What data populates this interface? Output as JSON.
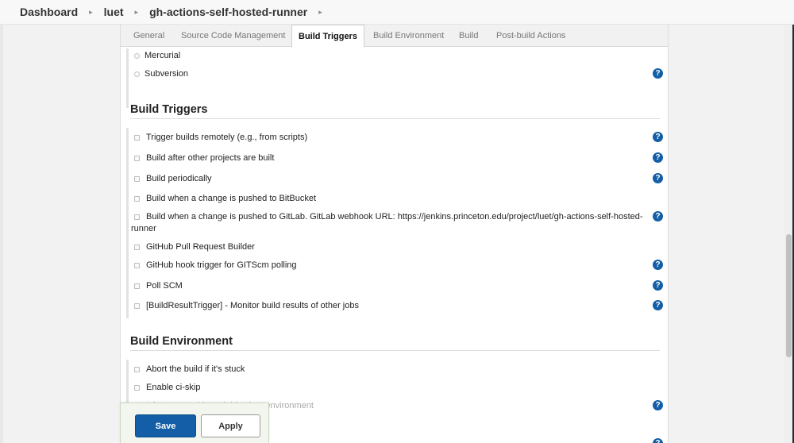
{
  "breadcrumb": {
    "items": [
      "Dashboard",
      "luet",
      "gh-actions-self-hosted-runner"
    ]
  },
  "tabs": [
    "General",
    "Source Code Management",
    "Build Triggers",
    "Build Environment",
    "Build",
    "Post-build Actions"
  ],
  "active_tab": "Build Triggers",
  "scm": {
    "options": [
      "Mercurial",
      "Subversion"
    ]
  },
  "build_triggers": {
    "title": "Build Triggers",
    "items": [
      "Trigger builds remotely (e.g., from scripts)",
      "Build after other projects are built",
      "Build periodically",
      "Build when a change is pushed to BitBucket",
      "Build when a change is pushed to GitLab. GitLab webhook URL: https://jenkins.princeton.edu/project/luet/gh-actions-self-hosted-",
      "runner",
      "GitHub Pull Request Builder",
      "GitHub hook trigger for GITScm polling",
      "Poll SCM",
      "[BuildResultTrigger] - Monitor build results of other jobs"
    ]
  },
  "build_environment": {
    "title": "Build Environment",
    "items": [
      "Abort the build if it's stuck",
      "Enable ci-skip",
      "Inject ownership variables into environment"
    ]
  },
  "buttons": {
    "save": "Save",
    "apply": "Apply"
  },
  "help_glyph": "?"
}
